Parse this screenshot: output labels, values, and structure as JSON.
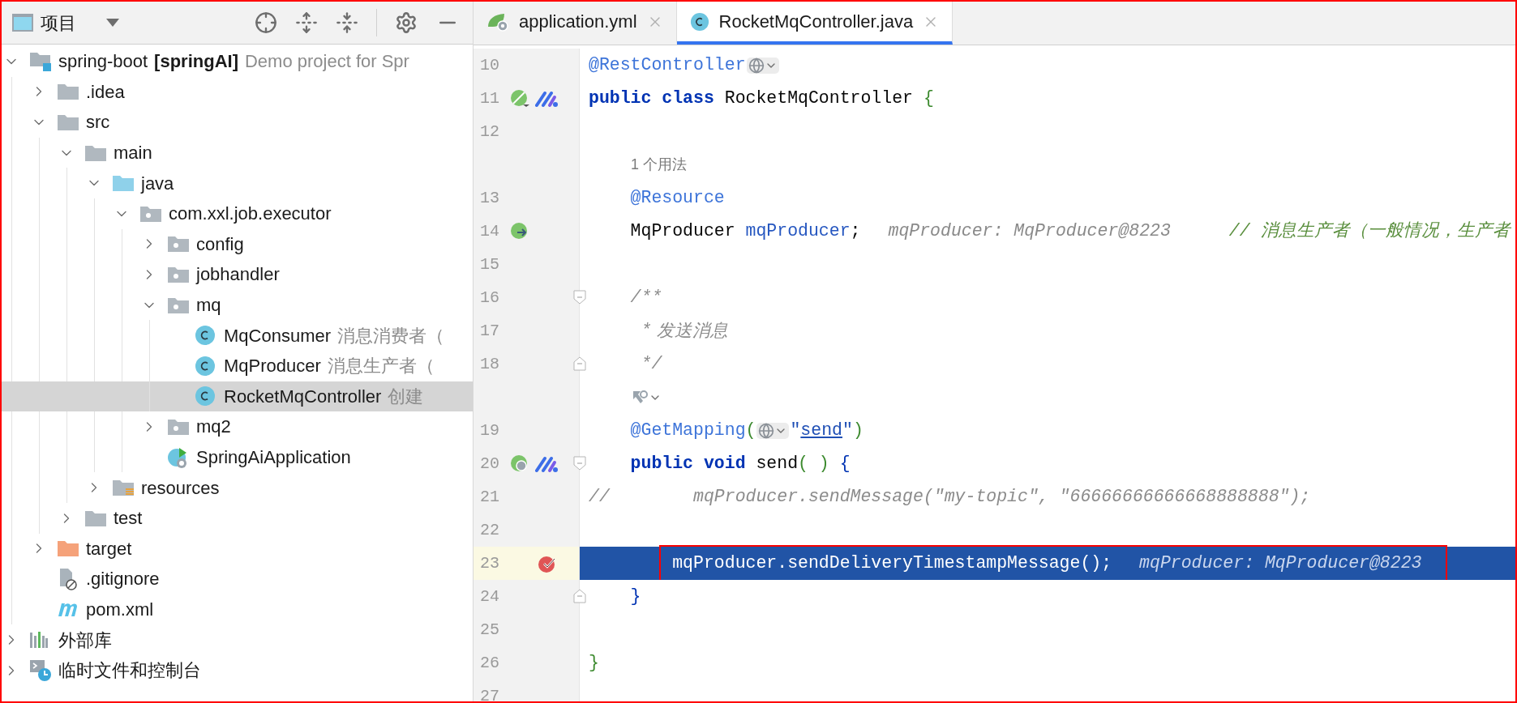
{
  "project_panel": {
    "title": "项目"
  },
  "tree": [
    {
      "label": "spring-boot",
      "module": "[springAI]",
      "note": "Demo project for Spr",
      "kind": "module",
      "expanded": true,
      "selected": false,
      "children": [
        {
          "label": ".idea",
          "kind": "folder",
          "expanded": false,
          "selected": false
        },
        {
          "label": "src",
          "kind": "folder",
          "expanded": true,
          "selected": false,
          "children": [
            {
              "label": "main",
              "kind": "folder",
              "expanded": true,
              "selected": false,
              "children": [
                {
                  "label": "java",
                  "kind": "source-folder",
                  "expanded": true,
                  "selected": false,
                  "children": [
                    {
                      "label": "com.xxl.job.executor",
                      "kind": "package",
                      "expanded": true,
                      "selected": false,
                      "children": [
                        {
                          "label": "config",
                          "kind": "package",
                          "expanded": false,
                          "selected": false
                        },
                        {
                          "label": "jobhandler",
                          "kind": "package",
                          "expanded": false,
                          "selected": false
                        },
                        {
                          "label": "mq",
                          "kind": "package",
                          "expanded": true,
                          "selected": false,
                          "children": [
                            {
                              "label": "MqConsumer",
                              "note": "消息消费者（",
                              "kind": "class",
                              "selected": false
                            },
                            {
                              "label": "MqProducer",
                              "note": "消息生产者（",
                              "kind": "class",
                              "selected": false
                            },
                            {
                              "label": "RocketMqController",
                              "note": "创建",
                              "kind": "class",
                              "selected": true
                            }
                          ]
                        },
                        {
                          "label": "mq2",
                          "kind": "package",
                          "expanded": false,
                          "selected": false
                        },
                        {
                          "label": "SpringAiApplication",
                          "kind": "spring-class",
                          "selected": false
                        }
                      ]
                    }
                  ]
                },
                {
                  "label": "resources",
                  "kind": "resources-folder",
                  "expanded": false,
                  "selected": false
                }
              ]
            },
            {
              "label": "test",
              "kind": "folder",
              "expanded": false,
              "selected": false
            }
          ]
        },
        {
          "label": "target",
          "kind": "excluded-folder",
          "expanded": false,
          "selected": false
        },
        {
          "label": ".gitignore",
          "kind": "ignored-file",
          "selected": false
        },
        {
          "label": "pom.xml",
          "kind": "maven",
          "selected": false
        }
      ]
    },
    {
      "label": "外部库",
      "kind": "library",
      "expanded": false,
      "selected": false
    },
    {
      "label": "临时文件和控制台",
      "kind": "scratches",
      "expanded": false,
      "selected": false
    }
  ],
  "tabs": [
    {
      "label": "application.yml",
      "kind": "yaml",
      "selected": false
    },
    {
      "label": "RocketMqController.java",
      "kind": "class",
      "selected": true
    }
  ],
  "editor": {
    "rows": [
      {
        "kind": "code",
        "number": "10",
        "current": false,
        "breakpoint": false,
        "segments": [
          {
            "kind": "annotation",
            "text": "@RestController"
          },
          {
            "kind": "url-inlay"
          }
        ]
      },
      {
        "kind": "code",
        "number": "11",
        "current": false,
        "breakpoint": false,
        "gutter_icons": [
          {
            "kind": "bean"
          },
          {
            "kind": "mybatis"
          }
        ],
        "segments": [
          {
            "kind": "keyword",
            "text": "public class"
          },
          {
            "kind": "plain",
            "text": " RocketMqController "
          },
          {
            "kind": "punct",
            "text": "{"
          }
        ]
      },
      {
        "kind": "code",
        "number": "12",
        "current": false,
        "breakpoint": false,
        "segments": []
      },
      {
        "kind": "inlay",
        "text": "1 个用法"
      },
      {
        "kind": "code",
        "number": "13",
        "current": false,
        "breakpoint": false,
        "segments": [
          {
            "kind": "annotation",
            "text": "    @Resource"
          }
        ]
      },
      {
        "kind": "code",
        "number": "14",
        "current": false,
        "breakpoint": false,
        "gutter_icons": [
          {
            "kind": "injection"
          }
        ],
        "segments": [
          {
            "kind": "plain",
            "text": "    MqProducer "
          },
          {
            "kind": "field",
            "text": "mqProducer"
          },
          {
            "kind": "plain",
            "text": ";"
          },
          {
            "kind": "hint",
            "text": "mqProducer: MqProducer@8223"
          },
          {
            "kind": "eol-comment",
            "text": "// 消息生产者（一般情况，生产者"
          }
        ]
      },
      {
        "kind": "code",
        "number": "15",
        "current": false,
        "breakpoint": false,
        "segments": []
      },
      {
        "kind": "code",
        "number": "16",
        "fold_marker": {
          "kind": "start"
        },
        "current": false,
        "breakpoint": false,
        "segments": [
          {
            "kind": "doc",
            "text": "    /**"
          }
        ]
      },
      {
        "kind": "code",
        "number": "17",
        "current": false,
        "breakpoint": false,
        "segments": [
          {
            "kind": "doc",
            "text": "     *"
          },
          {
            "kind": "doc-text",
            "text": " 发送消息"
          }
        ]
      },
      {
        "kind": "code",
        "number": "18",
        "fold_marker": {
          "kind": "end"
        },
        "current": false,
        "breakpoint": false,
        "segments": [
          {
            "kind": "doc",
            "text": "     */"
          }
        ]
      },
      {
        "kind": "widget"
      },
      {
        "kind": "code",
        "number": "19",
        "current": false,
        "breakpoint": false,
        "segments": [
          {
            "kind": "annotation",
            "text": "    @GetMapping"
          },
          {
            "kind": "punct",
            "text": "("
          },
          {
            "kind": "url-inlay"
          },
          {
            "kind": "quote",
            "text": "\""
          },
          {
            "kind": "link",
            "text": "send"
          },
          {
            "kind": "quote",
            "text": "\""
          },
          {
            "kind": "punct",
            "text": ")"
          }
        ]
      },
      {
        "kind": "code",
        "number": "20",
        "fold_marker": {
          "kind": "start"
        },
        "current": false,
        "breakpoint": false,
        "gutter_icons": [
          {
            "kind": "endpoint"
          },
          {
            "kind": "mybatis"
          }
        ],
        "segments": [
          {
            "kind": "keyword",
            "text": "    public void"
          },
          {
            "kind": "plain",
            "text": " send"
          },
          {
            "kind": "punct",
            "text": "( )"
          },
          {
            "kind": "brace",
            "text": " {"
          }
        ]
      },
      {
        "kind": "code",
        "number": "21",
        "current": false,
        "breakpoint": false,
        "segments": [
          {
            "kind": "comment",
            "text": "//        mqProducer.sendMessage(\"my-topic\", \"66666666666668888888\");"
          }
        ]
      },
      {
        "kind": "code",
        "number": "22",
        "current": false,
        "breakpoint": false,
        "segments": []
      },
      {
        "kind": "code",
        "number": "23",
        "current": true,
        "breakpoint": true,
        "boxed": true,
        "segments": [
          {
            "kind": "plain",
            "text": "        mqProducer.sendDeliveryTimestampMessage();"
          },
          {
            "kind": "hint",
            "text": "mqProducer: MqProducer@8223"
          }
        ]
      },
      {
        "kind": "code",
        "number": "24",
        "fold_marker": {
          "kind": "end"
        },
        "current": false,
        "breakpoint": false,
        "segments": [
          {
            "kind": "brace",
            "text": "    }"
          }
        ]
      },
      {
        "kind": "code",
        "number": "25",
        "current": false,
        "breakpoint": false,
        "segments": []
      },
      {
        "kind": "code",
        "number": "26",
        "current": false,
        "breakpoint": false,
        "segments": [
          {
            "kind": "punct",
            "text": "}"
          }
        ]
      },
      {
        "kind": "code",
        "number": "27",
        "current": false,
        "breakpoint": false,
        "segments": []
      }
    ]
  }
}
